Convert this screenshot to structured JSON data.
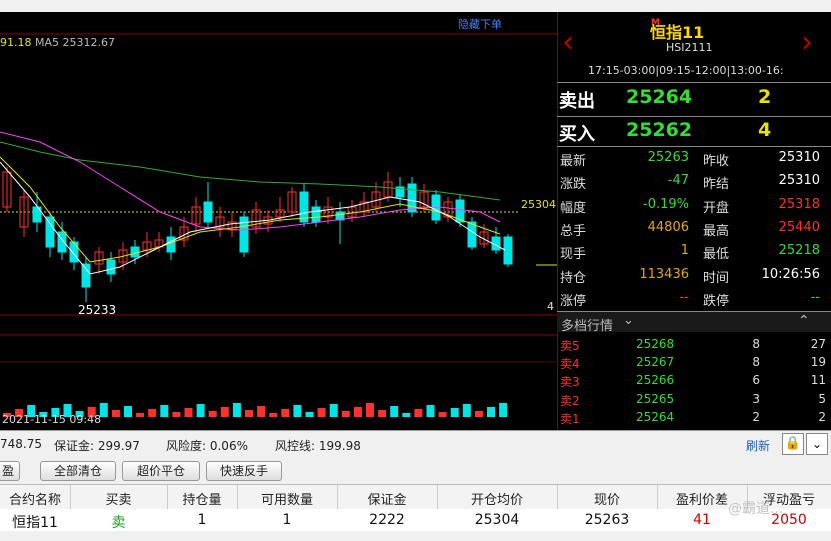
{
  "toolbar": {
    "items": [
      "",
      "",
      "",
      "",
      "",
      "",
      "",
      "",
      "",
      "",
      ""
    ]
  },
  "chart": {
    "hide_order_label": "隐藏下单",
    "ma_value_partial": "91.18",
    "ma5_label": "MA5 25312.67",
    "price_line_label": "25304",
    "low_label": "25233",
    "right_axis_small": "4",
    "candle_date": "2021-11-15 09:48",
    "colors": {
      "up": "#ff3030",
      "down": "#00e5e5",
      "ma5": "#ffffff",
      "ma10": "#e5e500",
      "ma20": "#ff40ff",
      "ma60": "#33aa33",
      "price_line": "#e5e500"
    }
  },
  "instrument": {
    "badge": "M",
    "name": "恒指11",
    "code": "HSI2111",
    "sessions": "17:15-03:00|09:15-12:00|13:00-16:"
  },
  "orderbook": {
    "sell_label": "卖出",
    "sell_price": "25264",
    "sell_qty": "2",
    "buy_label": "买入",
    "buy_price": "25262",
    "buy_qty": "4"
  },
  "quote": {
    "rows": [
      {
        "l1": "最新",
        "v1": "25263",
        "c1": "green",
        "l2": "昨收",
        "v2": "25310",
        "c2": "white"
      },
      {
        "l1": "涨跌",
        "v1": "-47",
        "c1": "green",
        "l2": "昨结",
        "v2": "25310",
        "c2": "white"
      },
      {
        "l1": "幅度",
        "v1": "-0.19%",
        "c1": "green",
        "l2": "开盘",
        "v2": "25318",
        "c2": "red"
      },
      {
        "l1": "总手",
        "v1": "44806",
        "c1": "orange",
        "l2": "最高",
        "v2": "25440",
        "c2": "red"
      },
      {
        "l1": "现手",
        "v1": "1",
        "c1": "orange",
        "l2": "最低",
        "v2": "25218",
        "c2": "green"
      },
      {
        "l1": "持仓",
        "v1": "113436",
        "c1": "orange",
        "l2": "时间",
        "v2": "10:26:56",
        "c2": "white"
      },
      {
        "l1": "涨停",
        "v1": "--",
        "c1": "red",
        "l2": "跌停",
        "v2": "--",
        "c2": "green"
      }
    ]
  },
  "depth": {
    "title": "多档行情",
    "rows": [
      {
        "label": "卖5",
        "price": "25268",
        "vol": "8",
        "total": "27"
      },
      {
        "label": "卖4",
        "price": "25267",
        "vol": "8",
        "total": "19"
      },
      {
        "label": "卖3",
        "price": "25266",
        "vol": "6",
        "total": "11"
      },
      {
        "label": "卖2",
        "price": "25265",
        "vol": "3",
        "total": "5"
      },
      {
        "label": "卖1",
        "price": "25264",
        "vol": "2",
        "total": "2"
      }
    ]
  },
  "account": {
    "balance_partial": "748.75",
    "margin_label": "保证金: 299.97",
    "risk_label": "风险度: 0.06%",
    "control_label": "风控线: 199.98",
    "refresh": "刷新"
  },
  "buttons": {
    "left_partial": "盈",
    "close_all": "全部清仓",
    "over_close": "超价平仓",
    "fast_reverse": "快速反手"
  },
  "positions": {
    "headers": [
      "合约名称",
      "买卖",
      "持仓量",
      "可用数量",
      "保证金",
      "开仓均价",
      "现价",
      "盈利价差",
      "浮动盈亏"
    ],
    "row": {
      "name": "恒指11",
      "side": "卖",
      "qty": "1",
      "avail": "1",
      "margin": "2222",
      "open": "25304",
      "current": "25263",
      "spread": "41",
      "pnl": "2050"
    }
  },
  "watermark": "@霸道..."
}
